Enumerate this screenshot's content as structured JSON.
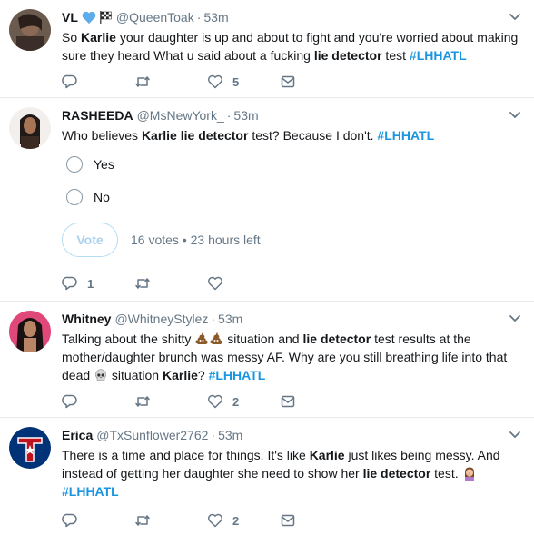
{
  "colors": {
    "link": "#1b95e0",
    "muted": "#657786",
    "text": "#14171a",
    "divider": "#e6ecf0"
  },
  "tweets": [
    {
      "name": "VL",
      "handle": "@QueenToak",
      "time": "53m",
      "header_icons": [
        "blue-heart-icon",
        "checkered-flag-icon"
      ],
      "text": {
        "t1": "So ",
        "b1": "Karlie",
        "t2": " your daughter is up and about to fight and you're worried about making sure they heard What u said about a fucking ",
        "b2": "lie detector",
        "t3": " test ",
        "tag": "#LHHATL"
      },
      "actions": {
        "reply": "",
        "retweet": "",
        "like": "5"
      }
    },
    {
      "name": "RASHEEDA",
      "handle": "@MsNewYork_",
      "time": "53m",
      "text": {
        "t1": "Who believes ",
        "b1": "Karlie lie detector",
        "t2": " test? Because I don't. ",
        "tag": "#LHHATL"
      },
      "poll": {
        "options": [
          "Yes",
          "No"
        ],
        "vote_label": "Vote",
        "votes": "16 votes",
        "separator": "•",
        "time_left": "23 hours left"
      },
      "actions": {
        "reply": "1",
        "retweet": "",
        "like": ""
      }
    },
    {
      "name": "Whitney",
      "handle": "@WhitneyStylez",
      "time": "53m",
      "text": {
        "t1": "Talking about the shitty ",
        "t2": " situation and ",
        "b1": "lie detector",
        "t3": " test results at the mother/daughter brunch was messy AF. Why are you still breathing life into that dead ",
        "t4": " situation ",
        "b2": "Karlie",
        "t5": "? ",
        "tag": "#LHHATL"
      },
      "emojis": [
        "poop-icon",
        "poop-icon",
        "skull-icon"
      ],
      "actions": {
        "reply": "",
        "retweet": "",
        "like": "2"
      }
    },
    {
      "name": "Erica",
      "handle": "@TxSunflower2762",
      "time": "53m",
      "text": {
        "t1": "There is a time and place for things. It's like ",
        "b1": "Karlie",
        "t2": " just likes being messy. And instead of getting her daughter she need to show her ",
        "b2": "lie detector",
        "t3": " test. ",
        "tag": "#LHHATL"
      },
      "emojis": [
        "facepalm-woman-icon"
      ],
      "actions": {
        "reply": "",
        "retweet": "",
        "like": "2"
      }
    }
  ]
}
